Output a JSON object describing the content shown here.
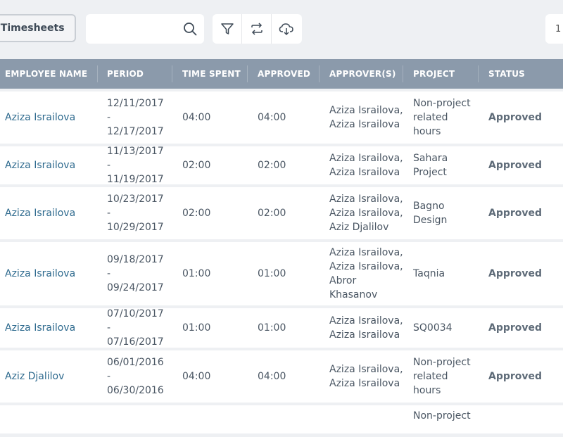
{
  "toolbar": {
    "timesheets_label": "e Timesheets",
    "search_placeholder": "",
    "pager_text": "1"
  },
  "table": {
    "columns": [
      "EMPLOYEE NAME",
      "PERIOD",
      "TIME SPENT",
      "APPROVED",
      "APPROVER(S)",
      "PROJECT",
      "STATUS"
    ],
    "rows": [
      {
        "name": "Aziza Israilova",
        "period": [
          "12/11/2017 -",
          "12/17/2017"
        ],
        "time": "04:00",
        "approved": "04:00",
        "approvers": [
          "Aziza Israilova,",
          "Aziza Israilova"
        ],
        "project": [
          "Non-project",
          "related",
          "hours"
        ],
        "status": "Approved"
      },
      {
        "name": "Aziza Israilova",
        "period": [
          "11/13/2017 -",
          "11/19/2017"
        ],
        "time": "02:00",
        "approved": "02:00",
        "approvers": [
          "Aziza Israilova,",
          "Aziza Israilova"
        ],
        "project": [
          "Sahara",
          "Project"
        ],
        "status": "Approved"
      },
      {
        "name": "Aziza Israilova",
        "period": [
          "10/23/2017 -",
          "10/29/2017"
        ],
        "time": "02:00",
        "approved": "02:00",
        "approvers": [
          "Aziza Israilova,",
          "Aziza Israilova,",
          "Aziz Djalilov"
        ],
        "project": [
          "Bagno",
          "Design"
        ],
        "status": "Approved"
      },
      {
        "name": "Aziza Israilova",
        "period": [
          "09/18/2017 -",
          "09/24/2017"
        ],
        "time": "01:00",
        "approved": "01:00",
        "approvers": [
          "Aziza Israilova,",
          "Aziza Israilova,",
          "Abror",
          "Khasanov"
        ],
        "project": [
          "Taqnia"
        ],
        "status": "Approved"
      },
      {
        "name": "Aziza Israilova",
        "period": [
          "07/10/2017 -",
          "07/16/2017"
        ],
        "time": "01:00",
        "approved": "01:00",
        "approvers": [
          "Aziza Israilova,",
          "Aziza Israilova"
        ],
        "project": [
          "SQ0034"
        ],
        "status": "Approved"
      },
      {
        "name": "Aziz Djalilov",
        "period": [
          "06/01/2016 -",
          "06/30/2016"
        ],
        "time": "04:00",
        "approved": "04:00",
        "approvers": [
          "Aziza Israilova,",
          "Aziza Israilova"
        ],
        "project": [
          "Non-project",
          "related",
          "hours"
        ],
        "status": "Approved"
      },
      {
        "name": "",
        "period": [
          "",
          ""
        ],
        "time": "",
        "approved": "",
        "approvers": [
          ""
        ],
        "project": [
          "Non-project"
        ],
        "status": ""
      }
    ]
  }
}
